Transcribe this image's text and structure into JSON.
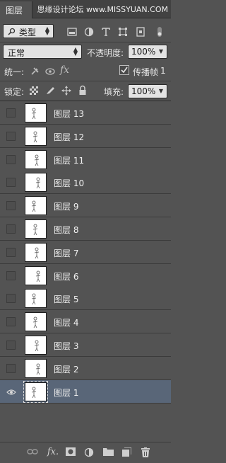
{
  "panel": {
    "tab_label": "图层",
    "watermark": "思缘设计论坛 www.MISSYUAN.COM"
  },
  "filter": {
    "kind_label": "类型",
    "icons": [
      "image-filter-icon",
      "adjustment-filter-icon",
      "type-filter-icon",
      "shape-filter-icon",
      "smart-object-filter-icon",
      "filter-toggle-icon"
    ]
  },
  "blend": {
    "mode": "正常",
    "opacity_label": "不透明度:",
    "opacity_value": "100%"
  },
  "unify": {
    "label": "统一:",
    "propagate_label": "传播帧",
    "propagate_checked": true,
    "frame_value": "1"
  },
  "lock": {
    "label": "锁定:",
    "fill_label": "填充:",
    "fill_value": "100%"
  },
  "layers": [
    {
      "name": "图层 13",
      "visible": false,
      "selected": false
    },
    {
      "name": "图层 12",
      "visible": false,
      "selected": false
    },
    {
      "name": "图层 11",
      "visible": false,
      "selected": false
    },
    {
      "name": "图层 10",
      "visible": false,
      "selected": false
    },
    {
      "name": "图层 9",
      "visible": false,
      "selected": false
    },
    {
      "name": "图层 8",
      "visible": false,
      "selected": false
    },
    {
      "name": "图层 7",
      "visible": false,
      "selected": false
    },
    {
      "name": "图层 6",
      "visible": false,
      "selected": false
    },
    {
      "name": "图层 5",
      "visible": false,
      "selected": false
    },
    {
      "name": "图层 4",
      "visible": false,
      "selected": false
    },
    {
      "name": "图层 3",
      "visible": false,
      "selected": false
    },
    {
      "name": "图层 2",
      "visible": false,
      "selected": false
    },
    {
      "name": "图层 1",
      "visible": true,
      "selected": true
    }
  ],
  "footer": {
    "icons": [
      "link-layers-icon",
      "fx-icon",
      "layer-mask-icon",
      "adjustment-layer-icon",
      "new-group-icon",
      "new-layer-icon",
      "delete-layer-icon"
    ]
  },
  "colors": {
    "panel_bg": "#535353",
    "selected_row": "#596678"
  }
}
